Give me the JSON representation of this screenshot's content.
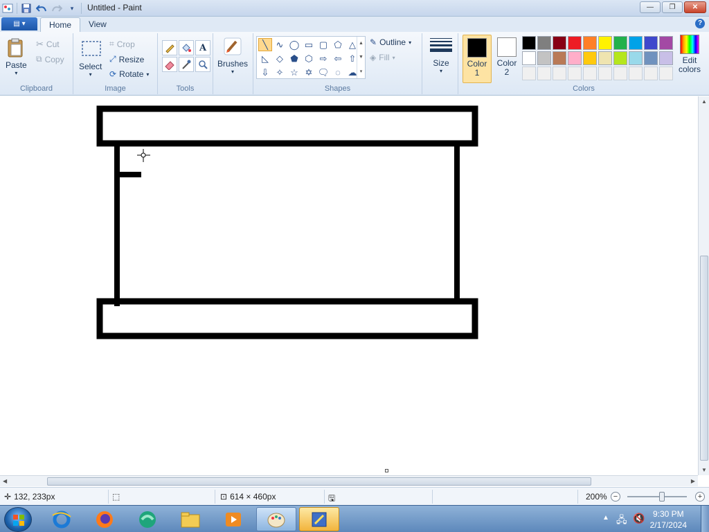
{
  "window": {
    "title": "Untitled - Paint",
    "minimize": "—",
    "restore": "❐",
    "close": "✕"
  },
  "tabs": {
    "app_menu": "▤ ▾",
    "home": "Home",
    "view": "View",
    "help": "?"
  },
  "ribbon": {
    "clipboard": {
      "label": "Clipboard",
      "paste": "Paste",
      "cut": "Cut",
      "copy": "Copy"
    },
    "image": {
      "label": "Image",
      "select": "Select",
      "crop": "Crop",
      "resize": "Resize",
      "rotate": "Rotate"
    },
    "tools": {
      "label": "Tools"
    },
    "brushes": {
      "label": "Brushes"
    },
    "shapes": {
      "label": "Shapes",
      "outline": "Outline",
      "fill": "Fill"
    },
    "size": {
      "label": "Size"
    },
    "colors": {
      "label": "Colors",
      "color1_label": "Color 1",
      "color2_label": "Color 2",
      "edit_colors": "Edit colors",
      "color1": "#000000",
      "color2": "#ffffff",
      "palette": [
        "#000000",
        "#7f7f7f",
        "#880015",
        "#ed1c24",
        "#ff7f27",
        "#fff200",
        "#22b14c",
        "#00a2e8",
        "#3f48cc",
        "#a349a4",
        "#ffffff",
        "#c3c3c3",
        "#b97a57",
        "#ffaec9",
        "#ffc90e",
        "#efe4b0",
        "#b5e61d",
        "#99d9ea",
        "#7092be",
        "#c8bfe7",
        "#f0f0f0",
        "#f0f0f0",
        "#f0f0f0",
        "#f0f0f0",
        "#f0f0f0",
        "#f0f0f0",
        "#f0f0f0",
        "#f0f0f0",
        "#f0f0f0",
        "#f0f0f0"
      ]
    }
  },
  "status": {
    "cursor_position": "132, 233px",
    "image_size": "614 × 460px",
    "zoom": "200%"
  },
  "taskbar": {
    "time": "9:30 PM",
    "date": "2/17/2024"
  }
}
